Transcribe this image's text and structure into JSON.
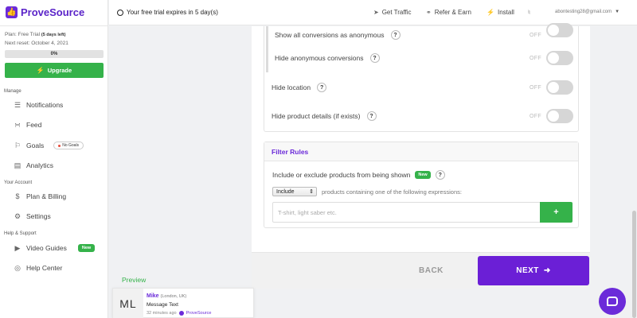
{
  "brand": {
    "name": "ProveSource"
  },
  "sidebar": {
    "plan_prefix": "Plan: Free Trial",
    "plan_days": "(5 days left)",
    "next_reset": "Next reset: October 4, 2021",
    "usage_percent": "0%",
    "upgrade_label": "Upgrade",
    "manage_label": "Manage",
    "account_label": "Your Account",
    "help_label": "Help & Support",
    "items": [
      {
        "label": "Notifications"
      },
      {
        "label": "Feed"
      },
      {
        "label": "Goals",
        "badge": "No Goals"
      },
      {
        "label": "Analytics"
      },
      {
        "label": "Plan & Billing"
      },
      {
        "label": "Settings"
      },
      {
        "label": "Video Guides",
        "badge": "New"
      },
      {
        "label": "Help Center"
      }
    ]
  },
  "topbar": {
    "trial_notice": "Your free trial expires in 5 day(s)",
    "get_traffic": "Get Traffic",
    "refer_earn": "Refer & Earn",
    "install": "Install",
    "email": "abontesting28@gmail.com"
  },
  "settings": {
    "off_label": "OFF",
    "rows": [
      {
        "label": "Show all conversions as anonymous",
        "value": "OFF"
      },
      {
        "label": "Hide anonymous conversions",
        "value": "OFF"
      },
      {
        "label": "Hide location",
        "value": "OFF"
      },
      {
        "label": "Hide product details (if exists)",
        "value": "OFF"
      }
    ]
  },
  "filter_rules": {
    "title": "Filter Rules",
    "description": "Include or exclude products from being shown",
    "new_badge": "New",
    "select_value": "Include",
    "select_suffix": "products containing one of the following expressions:",
    "input_placeholder": "T-shirt, light saber etc.",
    "add_label": "+"
  },
  "footer": {
    "back_label": "BACK",
    "next_label": "NEXT"
  },
  "preview": {
    "label": "Preview",
    "avatar_initials": "ML",
    "name": "Mike",
    "location": "(London, UK)",
    "message": "Message Text",
    "time": "32 minutes ago",
    "brand": "ProveSource"
  },
  "colors": {
    "brand_purple": "#6b2bd9",
    "success_green": "#35b24a"
  }
}
